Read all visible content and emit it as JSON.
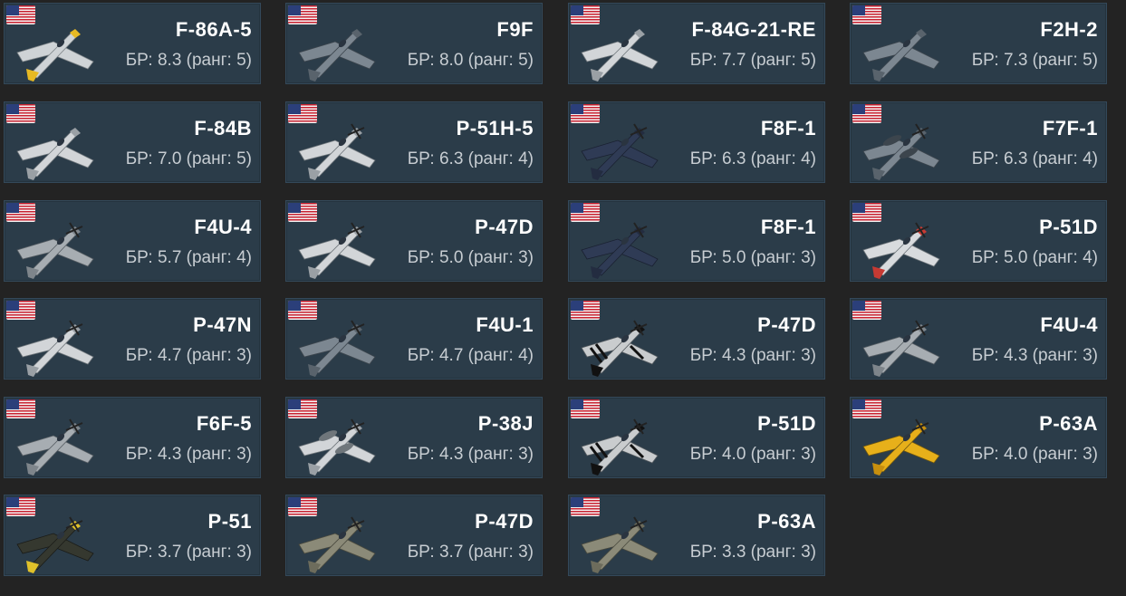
{
  "colors": {
    "background": "#232323",
    "card_bg": "#2b3c49",
    "card_border": "#34495a",
    "name_text": "#ffffff",
    "br_text": "#c7cdd2"
  },
  "vehicles": [
    {
      "name": "F-86A-5",
      "br": "БР: 8.3 (ранг: 5)",
      "flag_icon": "us-flag-icon",
      "plane_icon": "jet-icon",
      "livery": "silver-yellow"
    },
    {
      "name": "F9F",
      "br": "БР: 8.0 (ранг: 5)",
      "flag_icon": "us-flag-icon",
      "plane_icon": "jet-icon",
      "livery": "navy-grey"
    },
    {
      "name": "F-84G-21-RE",
      "br": "БР: 7.7 (ранг: 5)",
      "flag_icon": "us-flag-icon",
      "plane_icon": "jet-icon",
      "livery": "silver"
    },
    {
      "name": "F2H-2",
      "br": "БР: 7.3 (ранг: 5)",
      "flag_icon": "us-flag-icon",
      "plane_icon": "jet-icon",
      "livery": "navy-grey"
    },
    {
      "name": "F-84B",
      "br": "БР: 7.0 (ранг: 5)",
      "flag_icon": "us-flag-icon",
      "plane_icon": "jet-icon",
      "livery": "silver"
    },
    {
      "name": "P-51H-5",
      "br": "БР: 6.3 (ранг: 4)",
      "flag_icon": "us-flag-icon",
      "plane_icon": "propeller-plane-icon",
      "livery": "silver"
    },
    {
      "name": "F8F-1",
      "br": "БР: 6.3 (ранг: 4)",
      "flag_icon": "us-flag-icon",
      "plane_icon": "propeller-plane-icon",
      "livery": "navy-blue"
    },
    {
      "name": "F7F-1",
      "br": "БР: 6.3 (ранг: 4)",
      "flag_icon": "us-flag-icon",
      "plane_icon": "twin-engine-plane-icon",
      "livery": "navy-grey"
    },
    {
      "name": "F4U-4",
      "br": "БР: 5.7 (ранг: 4)",
      "flag_icon": "us-flag-icon",
      "plane_icon": "propeller-plane-icon",
      "livery": "grey"
    },
    {
      "name": "P-47D",
      "br": "БР: 5.0 (ранг: 3)",
      "flag_icon": "us-flag-icon",
      "plane_icon": "propeller-plane-icon",
      "livery": "silver"
    },
    {
      "name": "F8F-1",
      "br": "БР: 5.0 (ранг: 3)",
      "flag_icon": "us-flag-icon",
      "plane_icon": "propeller-plane-icon",
      "livery": "navy-blue"
    },
    {
      "name": "P-51D",
      "br": "БР: 5.0 (ранг: 4)",
      "flag_icon": "us-flag-icon",
      "plane_icon": "propeller-plane-icon",
      "livery": "silver-red"
    },
    {
      "name": "P-47N",
      "br": "БР: 4.7 (ранг: 3)",
      "flag_icon": "us-flag-icon",
      "plane_icon": "propeller-plane-icon",
      "livery": "silver"
    },
    {
      "name": "F4U-1",
      "br": "БР: 4.7 (ранг: 4)",
      "flag_icon": "us-flag-icon",
      "plane_icon": "propeller-plane-icon",
      "livery": "navy-grey"
    },
    {
      "name": "P-47D",
      "br": "БР: 4.3 (ранг: 3)",
      "flag_icon": "us-flag-icon",
      "plane_icon": "propeller-plane-icon",
      "livery": "invasion-stripes"
    },
    {
      "name": "F4U-4",
      "br": "БР: 4.3 (ранг: 3)",
      "flag_icon": "us-flag-icon",
      "plane_icon": "propeller-plane-icon",
      "livery": "grey"
    },
    {
      "name": "F6F-5",
      "br": "БР: 4.3 (ранг: 3)",
      "flag_icon": "us-flag-icon",
      "plane_icon": "propeller-plane-icon",
      "livery": "grey"
    },
    {
      "name": "P-38J",
      "br": "БР: 4.3 (ранг: 3)",
      "flag_icon": "us-flag-icon",
      "plane_icon": "twin-boom-plane-icon",
      "livery": "silver"
    },
    {
      "name": "P-51D",
      "br": "БР: 4.0 (ранг: 3)",
      "flag_icon": "us-flag-icon",
      "plane_icon": "propeller-plane-icon",
      "livery": "invasion-stripes"
    },
    {
      "name": "P-63A",
      "br": "БР: 4.0 (ранг: 3)",
      "flag_icon": "us-flag-icon",
      "plane_icon": "propeller-plane-icon",
      "livery": "yellow"
    },
    {
      "name": "P-51",
      "br": "БР: 3.7 (ранг: 3)",
      "flag_icon": "us-flag-icon",
      "plane_icon": "propeller-plane-icon",
      "livery": "black-yellow"
    },
    {
      "name": "P-47D",
      "br": "БР: 3.7 (ранг: 3)",
      "flag_icon": "us-flag-icon",
      "plane_icon": "propeller-plane-icon",
      "livery": "olive"
    },
    {
      "name": "P-63A",
      "br": "БР: 3.3 (ранг: 3)",
      "flag_icon": "us-flag-icon",
      "plane_icon": "propeller-plane-icon",
      "livery": "olive"
    }
  ]
}
